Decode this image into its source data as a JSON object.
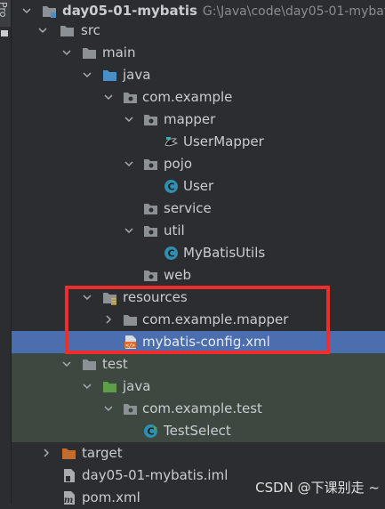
{
  "side_tab": {
    "label": "Pro"
  },
  "tree": {
    "root": {
      "label": "day05-01-mybatis",
      "path": "G:\\Java\\code\\day05-01-mybat"
    },
    "src": "src",
    "main": "main",
    "java": "java",
    "pkg_example": "com.example",
    "mapper_pkg": "mapper",
    "user_mapper": "UserMapper",
    "pojo_pkg": "pojo",
    "user_class": "User",
    "service_pkg": "service",
    "util_pkg": "util",
    "mybatis_utils": "MyBatisUtils",
    "web_pkg": "web",
    "resources": "resources",
    "res_mapper_pkg": "com.example.mapper",
    "mybatis_config": "mybatis-config.xml",
    "test": "test",
    "test_java": "java",
    "test_pkg": "com.example.test",
    "test_select": "TestSelect",
    "target": "target",
    "iml": "day05-01-mybatis.iml",
    "pom": "pom.xml"
  },
  "watermark": "CSDN @下课别走 ~",
  "colors": {
    "background": "#2b2d30",
    "selection": "#4b6eaf",
    "test_band": "#3d4840",
    "folder": "#8c9196",
    "source_root": "#4a90c8",
    "test_root": "#5c9e4a",
    "excluded": "#c46b2e",
    "class_icon": "#2f8fb0",
    "highlight": "#ee2d2d"
  }
}
